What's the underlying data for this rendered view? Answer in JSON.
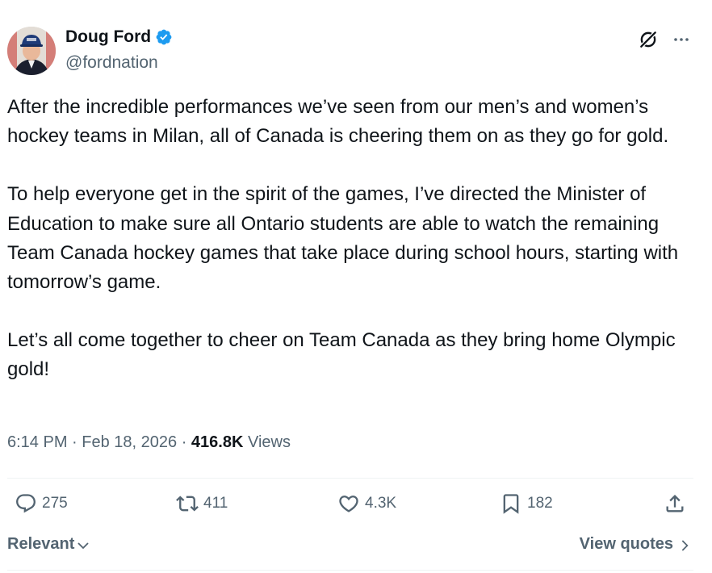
{
  "author": {
    "name": "Doug Ford",
    "handle": "@fordnation",
    "verified_icon": "verified-badge-icon"
  },
  "tweet": {
    "paragraphs": [
      "After the incredible performances we’ve seen from our men’s and women’s hockey teams in Milan, all of Canada is cheering them on as they go for gold.",
      "To help everyone get in the spirit of the games, I’ve directed the Minister of Education to make sure all Ontario students are able to watch the remaining Team Canada hockey games that take place during school hours, starting with tomorrow’s game.",
      "Let’s all come together to cheer on Team Canada as they bring home Olympic gold!"
    ],
    "time": "6:14 PM",
    "date": "Feb 18, 2026",
    "views_count": "416.8K",
    "views_label": "Views"
  },
  "actions": {
    "replies": "275",
    "reposts": "411",
    "likes": "4.3K",
    "bookmarks": "182"
  },
  "footer": {
    "sort_label": "Relevant",
    "quotes_label": "View quotes"
  },
  "colors": {
    "text": "#0f1419",
    "secondary": "#536471",
    "verified": "#1d9bf0",
    "divider": "#eff3f4"
  }
}
